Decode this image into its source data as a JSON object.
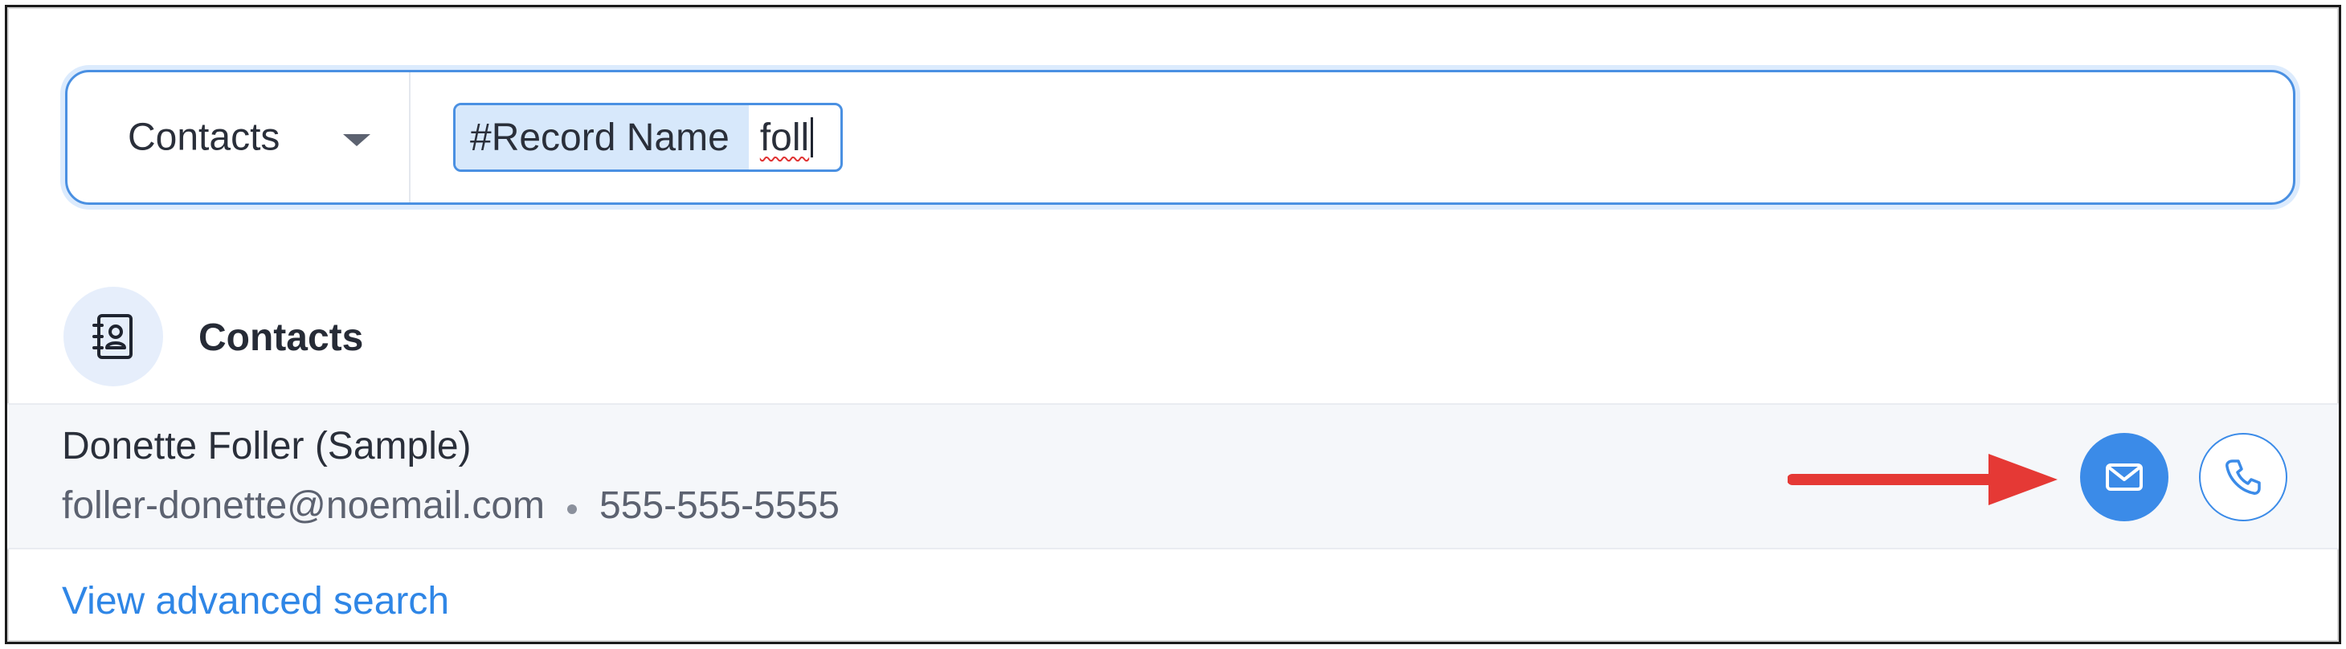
{
  "search": {
    "module_label": "Contacts",
    "chip_field": "#Record Name",
    "chip_value": "foll"
  },
  "section": {
    "title": "Contacts",
    "icon": "contact-book-icon"
  },
  "result": {
    "name": "Donette Foller (Sample)",
    "email": "foller-donette@noemail.com",
    "phone": "555-555-5555",
    "actions": [
      "email-icon",
      "phone-icon"
    ]
  },
  "footer": {
    "advanced_link": "View advanced search"
  },
  "colors": {
    "accent": "#3b8be8",
    "annotation_arrow": "#e53935",
    "chip_bg": "#d7e8fb"
  }
}
